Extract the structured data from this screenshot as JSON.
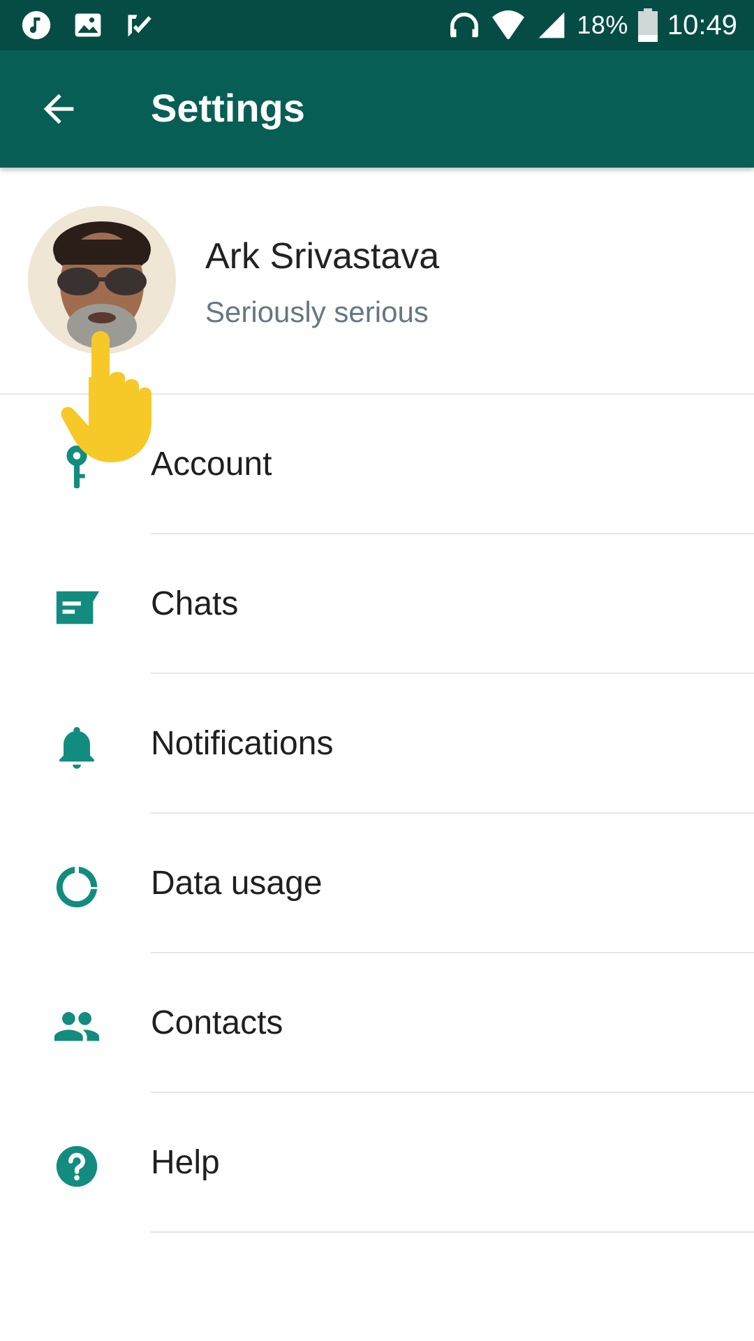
{
  "status_bar": {
    "battery": "18%",
    "time": "10:49"
  },
  "app_bar": {
    "title": "Settings"
  },
  "profile": {
    "name": "Ark Srivastava",
    "status": "Seriously serious"
  },
  "menu": {
    "items": [
      {
        "label": "Account",
        "icon": "key-icon"
      },
      {
        "label": "Chats",
        "icon": "chat-icon"
      },
      {
        "label": "Notifications",
        "icon": "bell-icon"
      },
      {
        "label": "Data usage",
        "icon": "data-usage-icon"
      },
      {
        "label": "Contacts",
        "icon": "contacts-icon"
      },
      {
        "label": "Help",
        "icon": "help-icon"
      }
    ]
  },
  "colors": {
    "status_bar": "#054d44",
    "app_bar": "#075e54",
    "accent": "#128c7e",
    "text_primary": "#1f1f1f",
    "text_secondary": "#667781"
  }
}
